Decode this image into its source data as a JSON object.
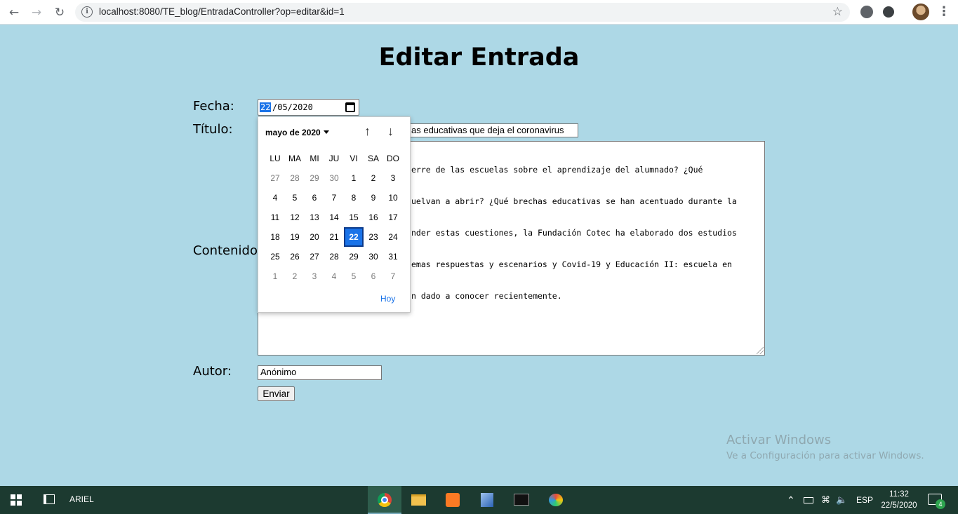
{
  "browser": {
    "url": "localhost:8080/TE_blog/EntradaController?op=editar&id=1"
  },
  "page": {
    "title": "Editar Entrada"
  },
  "form": {
    "fecha_label": "Fecha:",
    "fecha_day": "22",
    "fecha_rest": "/05/2020",
    "titulo_label": "Título:",
    "titulo_value": "as educativas que deja el coronavirus",
    "contenido_label": "Contenido:",
    "contenido_lines": [
      "erre de las escuelas sobre el aprendizaje del alumnado? ¿Qué",
      "uelvan a abrir? ¿Qué brechas educativas se han acentuado durante la",
      "nder estas cuestiones, la Fundación Cotec ha elaborado dos estudios",
      "emas respuestas y escenarios y Covid-19 y Educación II: escuela en",
      "n dado a conocer recientemente."
    ],
    "autor_label": "Autor:",
    "autor_value": "Anónimo",
    "submit_label": "Enviar"
  },
  "datepicker": {
    "month_label": "mayo de 2020",
    "weekdays": [
      "LU",
      "MA",
      "MI",
      "JU",
      "VI",
      "SA",
      "DO"
    ],
    "weeks": [
      [
        "27",
        "28",
        "29",
        "30",
        "1",
        "2",
        "3"
      ],
      [
        "4",
        "5",
        "6",
        "7",
        "8",
        "9",
        "10"
      ],
      [
        "11",
        "12",
        "13",
        "14",
        "15",
        "16",
        "17"
      ],
      [
        "18",
        "19",
        "20",
        "21",
        "22",
        "23",
        "24"
      ],
      [
        "25",
        "26",
        "27",
        "28",
        "29",
        "30",
        "31"
      ],
      [
        "1",
        "2",
        "3",
        "4",
        "5",
        "6",
        "7"
      ]
    ],
    "selected_day": "22",
    "today_label": "Hoy"
  },
  "watermark": {
    "line1": "Activar Windows",
    "line2": "Ve a Configuración para activar Windows."
  },
  "taskbar": {
    "user": "ARIEL",
    "language": "ESP",
    "time": "11:32",
    "date": "22/5/2020",
    "notifications": "4"
  },
  "colors": {
    "page_background": "#add8e6",
    "accent": "#1a73e8",
    "taskbar": "#1c3a30"
  }
}
